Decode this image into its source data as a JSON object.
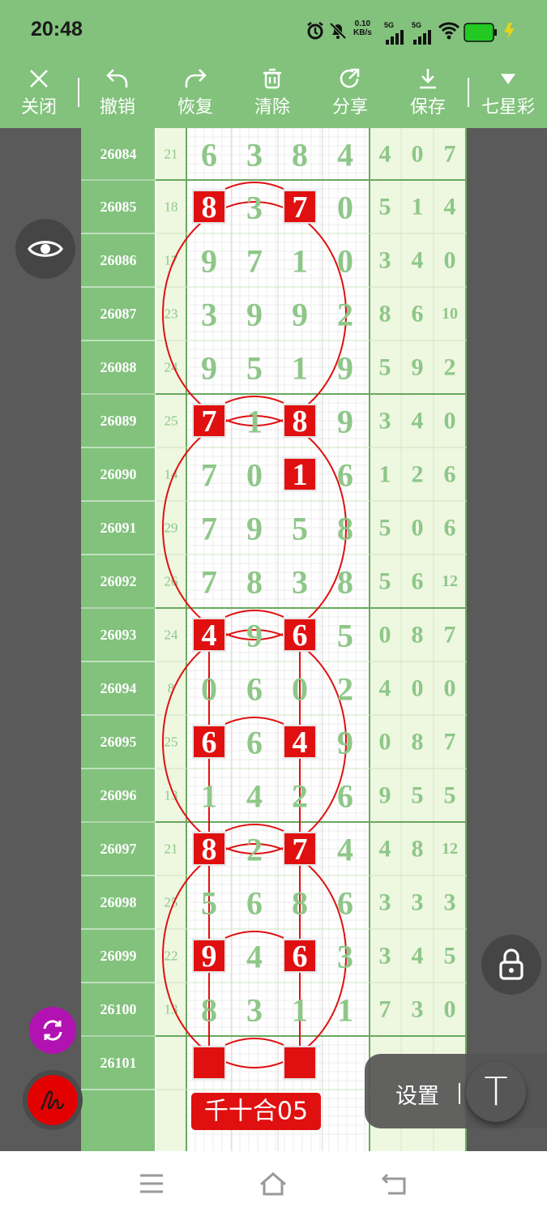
{
  "status_bar": {
    "time": "20:48",
    "net_speed_value": "0.10",
    "net_speed_unit": "KB/s",
    "signal1": "5G",
    "signal2": "5G",
    "icons": [
      "alarm-icon",
      "mute-bell-icon",
      "signal-icon",
      "signal-icon",
      "wifi-icon",
      "battery-icon",
      "charging-icon"
    ]
  },
  "toolbar": {
    "close": "关闭",
    "undo": "撤销",
    "redo": "恢复",
    "clear": "清除",
    "share": "分享",
    "save": "保存",
    "lottery": "七星彩"
  },
  "chart": {
    "rows": [
      {
        "issue": "26084",
        "sum": "21",
        "digits": [
          "6",
          "3",
          "8",
          "4"
        ],
        "right": [
          "4",
          "0",
          "7"
        ]
      },
      {
        "issue": "26085",
        "sum": "18",
        "digits": [
          "8",
          "3",
          "7",
          "0"
        ],
        "right": [
          "5",
          "1",
          "4"
        ]
      },
      {
        "issue": "26086",
        "sum": "17",
        "digits": [
          "9",
          "7",
          "1",
          "0"
        ],
        "right": [
          "3",
          "4",
          "0"
        ]
      },
      {
        "issue": "26087",
        "sum": "23",
        "digits": [
          "3",
          "9",
          "9",
          "2"
        ],
        "right": [
          "8",
          "6",
          "10"
        ]
      },
      {
        "issue": "26088",
        "sum": "24",
        "digits": [
          "9",
          "5",
          "1",
          "9"
        ],
        "right": [
          "5",
          "9",
          "2"
        ]
      },
      {
        "issue": "26089",
        "sum": "25",
        "digits": [
          "7",
          "1",
          "8",
          "9"
        ],
        "right": [
          "3",
          "4",
          "0"
        ]
      },
      {
        "issue": "26090",
        "sum": "14",
        "digits": [
          "7",
          "0",
          "1",
          "6"
        ],
        "right": [
          "1",
          "2",
          "6"
        ]
      },
      {
        "issue": "26091",
        "sum": "29",
        "digits": [
          "7",
          "9",
          "5",
          "8"
        ],
        "right": [
          "5",
          "0",
          "6"
        ]
      },
      {
        "issue": "26092",
        "sum": "26",
        "digits": [
          "7",
          "8",
          "3",
          "8"
        ],
        "right": [
          "5",
          "6",
          "12"
        ]
      },
      {
        "issue": "26093",
        "sum": "24",
        "digits": [
          "4",
          "9",
          "6",
          "5"
        ],
        "right": [
          "0",
          "8",
          "7"
        ]
      },
      {
        "issue": "26094",
        "sum": "8",
        "digits": [
          "0",
          "6",
          "0",
          "2"
        ],
        "right": [
          "4",
          "0",
          "0"
        ]
      },
      {
        "issue": "26095",
        "sum": "25",
        "digits": [
          "6",
          "6",
          "4",
          "9"
        ],
        "right": [
          "0",
          "8",
          "7"
        ]
      },
      {
        "issue": "26096",
        "sum": "13",
        "digits": [
          "1",
          "4",
          "2",
          "6"
        ],
        "right": [
          "9",
          "5",
          "5"
        ]
      },
      {
        "issue": "26097",
        "sum": "21",
        "digits": [
          "8",
          "2",
          "7",
          "4"
        ],
        "right": [
          "4",
          "8",
          "12"
        ]
      },
      {
        "issue": "26098",
        "sum": "25",
        "digits": [
          "5",
          "6",
          "8",
          "6"
        ],
        "right": [
          "3",
          "3",
          "3"
        ]
      },
      {
        "issue": "26099",
        "sum": "22",
        "digits": [
          "9",
          "4",
          "6",
          "3"
        ],
        "right": [
          "3",
          "4",
          "5"
        ]
      },
      {
        "issue": "26100",
        "sum": "13",
        "digits": [
          "8",
          "3",
          "1",
          "1"
        ],
        "right": [
          "7",
          "3",
          "0"
        ]
      },
      {
        "issue": "26101",
        "sum": "",
        "digits": [
          "",
          "",
          "",
          ""
        ],
        "right": [
          "",
          "",
          ""
        ]
      },
      {
        "issue": "",
        "sum": "",
        "digits": [
          "",
          "",
          "",
          ""
        ],
        "right": [
          "",
          "",
          ""
        ]
      }
    ],
    "highlights": [
      [
        1,
        0
      ],
      [
        1,
        2
      ],
      [
        5,
        0
      ],
      [
        5,
        2
      ],
      [
        6,
        2
      ],
      [
        9,
        0
      ],
      [
        9,
        2
      ],
      [
        11,
        0
      ],
      [
        11,
        2
      ],
      [
        13,
        0
      ],
      [
        13,
        2
      ],
      [
        15,
        0
      ],
      [
        15,
        2
      ],
      [
        17,
        0
      ],
      [
        17,
        2
      ]
    ],
    "label": "千十合05",
    "colors": {
      "green": "#82c27c",
      "light_green": "#eef7e0",
      "digit": "#8ec788",
      "red": "#e01010",
      "gray": "#5a5a5a"
    }
  },
  "floating": {
    "settings_label": "设置",
    "text_tool": "T"
  },
  "nav_icons": [
    "menu-icon",
    "home-icon",
    "back-icon"
  ]
}
